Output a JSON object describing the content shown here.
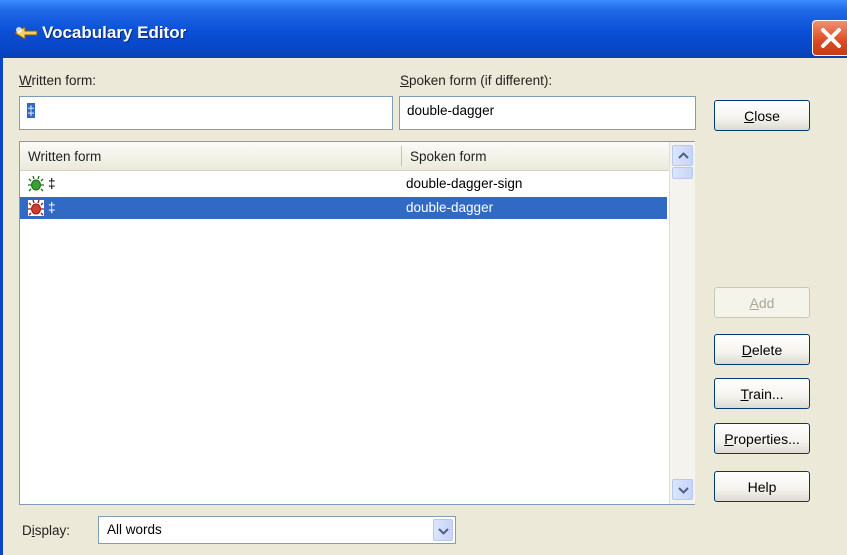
{
  "window": {
    "title": "Vocabulary Editor"
  },
  "fields": {
    "written_label_prefix": "",
    "written_label_ul": "W",
    "written_label_rest": "ritten form:",
    "written_value": "‡",
    "spoken_label_ul": "S",
    "spoken_label_rest": "poken form (if different):",
    "spoken_value": "double-dagger"
  },
  "list": {
    "columns": [
      "Written form",
      "Spoken form"
    ],
    "rows": [
      {
        "written": "‡",
        "spoken": "double-dagger-sign",
        "icon": "green-bug-icon",
        "selected": false
      },
      {
        "written": "‡",
        "spoken": "double-dagger",
        "icon": "red-bug-icon",
        "selected": true
      }
    ]
  },
  "buttons": {
    "close": {
      "ul": "C",
      "rest": "lose"
    },
    "add": {
      "ul": "A",
      "rest": "dd",
      "enabled": false
    },
    "delete": {
      "ul": "D",
      "rest": "elete"
    },
    "train": {
      "ul": "T",
      "rest": "rain..."
    },
    "properties": {
      "ul": "P",
      "rest": "roperties..."
    },
    "help": {
      "label": "Help"
    }
  },
  "display": {
    "label_pre": "D",
    "label_ul": "i",
    "label_rest": "splay:",
    "value": "All words"
  },
  "colors": {
    "titlebar": "#0a4fd6",
    "selection": "#316ac5",
    "face": "#ece9d8"
  }
}
